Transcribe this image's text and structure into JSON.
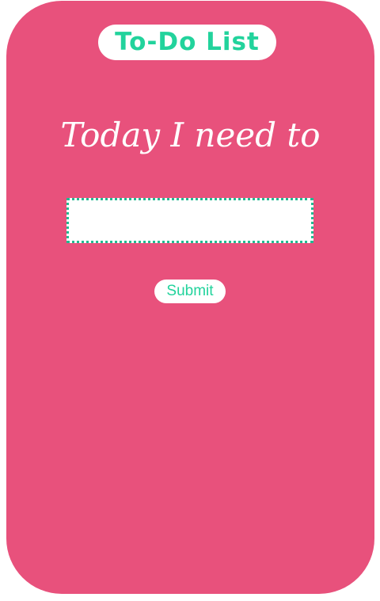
{
  "header": {
    "title": "To-Do List"
  },
  "prompt": {
    "text": "Today I need to"
  },
  "task_input": {
    "value": "",
    "placeholder": ""
  },
  "submit": {
    "label": "Submit"
  },
  "colors": {
    "card_background": "#e8517c",
    "accent": "#22d39c",
    "page_background": "#ffffff"
  }
}
